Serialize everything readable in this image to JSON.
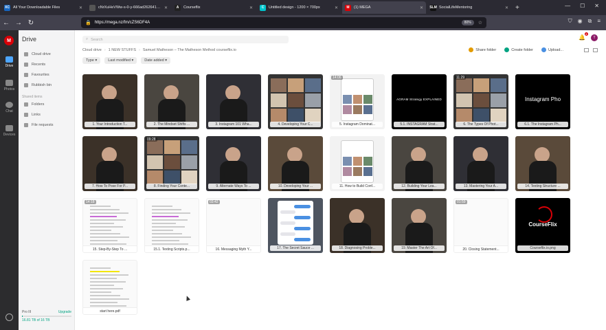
{
  "browser": {
    "tabs": [
      {
        "label": "All Your Downloadable Files",
        "fav": "XC",
        "color": "#1565c0"
      },
      {
        "label": "cNrXuHeVWw-s-0-y-666ad2626419fe4f0",
        "fav": "",
        "color": "#555"
      },
      {
        "label": "Courseflix",
        "fav": "A",
        "color": "#222"
      },
      {
        "label": "Untitled design - 1200 × 700px",
        "fav": "C",
        "color": "#00c4cc"
      },
      {
        "label": "(1) MEGA",
        "fav": "M",
        "color": "#d90007"
      },
      {
        "label": "SocialLifeMentoring",
        "fav": "SLM",
        "color": "#111"
      }
    ],
    "url": "https://mega.nz/fm/cZS6DF4A",
    "zoom": "80%"
  },
  "rail": {
    "items": [
      {
        "label": "Drive"
      },
      {
        "label": "Photos"
      },
      {
        "label": "Chat"
      },
      {
        "label": "Devices"
      }
    ]
  },
  "sidebar": {
    "title": "Drive",
    "items": [
      "Cloud drive",
      "Recents",
      "Favourites",
      "Rubbish bin"
    ],
    "section": "Shared items",
    "shared": [
      "Folders",
      "Links",
      "File requests"
    ],
    "storage": {
      "plan": "Pro III",
      "upgrade": "Upgrade",
      "used": "16.81 TB of 16 TB",
      "fraction": 0.01
    }
  },
  "main": {
    "search_placeholder": "Search",
    "notifications": "2",
    "avatar": "T",
    "breadcrumb": [
      "Cloud drive",
      "1 NEW STUFFS",
      "Samuel Matheson – The Matheson Method courseflix.io"
    ],
    "actions": {
      "share": "Share folder",
      "create": "Create folder",
      "upload": "Upload..."
    },
    "filters": [
      "Type",
      "Last modified",
      "Date added"
    ],
    "files": [
      {
        "label": "1. Your Introduction T...",
        "badge": "",
        "kind": "video"
      },
      {
        "label": "2. The Mindset Shifts ...",
        "badge": "",
        "kind": "video"
      },
      {
        "label": "3. Instagram 101 Wha...",
        "badge": "",
        "kind": "video"
      },
      {
        "label": "4. Developing Your C...",
        "badge": "",
        "kind": "collage"
      },
      {
        "label": "5. Instagram Dominat...",
        "badge": "14:06",
        "kind": "phone"
      },
      {
        "label": "5.1. INSTAGRAM Strat...",
        "badge": "",
        "kind": "text",
        "text": "AGRAM Strategy EXPLAINED"
      },
      {
        "label": "6. The Types Of Phot...",
        "badge": "11:29",
        "kind": "collage"
      },
      {
        "label": "6.1. The Instagram Ph...",
        "badge": "",
        "kind": "big",
        "text": "Instagram Pho"
      },
      {
        "label": "7. How To Pose For P...",
        "badge": "",
        "kind": "video"
      },
      {
        "label": "8. Finding Your Conte...",
        "badge": "09:28",
        "kind": "collage"
      },
      {
        "label": "9. Alternate Ways To ...",
        "badge": "",
        "kind": "video"
      },
      {
        "label": "10. Developing Your ...",
        "badge": "",
        "kind": "video"
      },
      {
        "label": "11. How to Build Conf...",
        "badge": "",
        "kind": "phone"
      },
      {
        "label": "12. Building Your Lea...",
        "badge": "",
        "kind": "video"
      },
      {
        "label": "13. Mastering Your A...",
        "badge": "",
        "kind": "video"
      },
      {
        "label": "14. Texting Structure ...",
        "badge": "",
        "kind": "video"
      },
      {
        "label": "15. Step-By-Step To ...",
        "badge": "14:18",
        "kind": "doc"
      },
      {
        "label": "15.1. Texting Scripts.p...",
        "badge": "",
        "kind": "doc"
      },
      {
        "label": "16. Messaging Myth Y...",
        "badge": "03:42",
        "kind": "blank"
      },
      {
        "label": "17. The Secret Sauce ...",
        "badge": "",
        "kind": "chat"
      },
      {
        "label": "18. Diagnosing Proble...",
        "badge": "",
        "kind": "video"
      },
      {
        "label": "19. Master The Art Of...",
        "badge": "",
        "kind": "video"
      },
      {
        "label": "20. Closing Statement...",
        "badge": "01:59",
        "kind": "blank"
      },
      {
        "label": "Courseflix.io.png",
        "badge": "",
        "kind": "logo",
        "text": "CourseFlix"
      },
      {
        "label": "start here.pdf",
        "badge": "",
        "kind": "pdf"
      }
    ]
  }
}
